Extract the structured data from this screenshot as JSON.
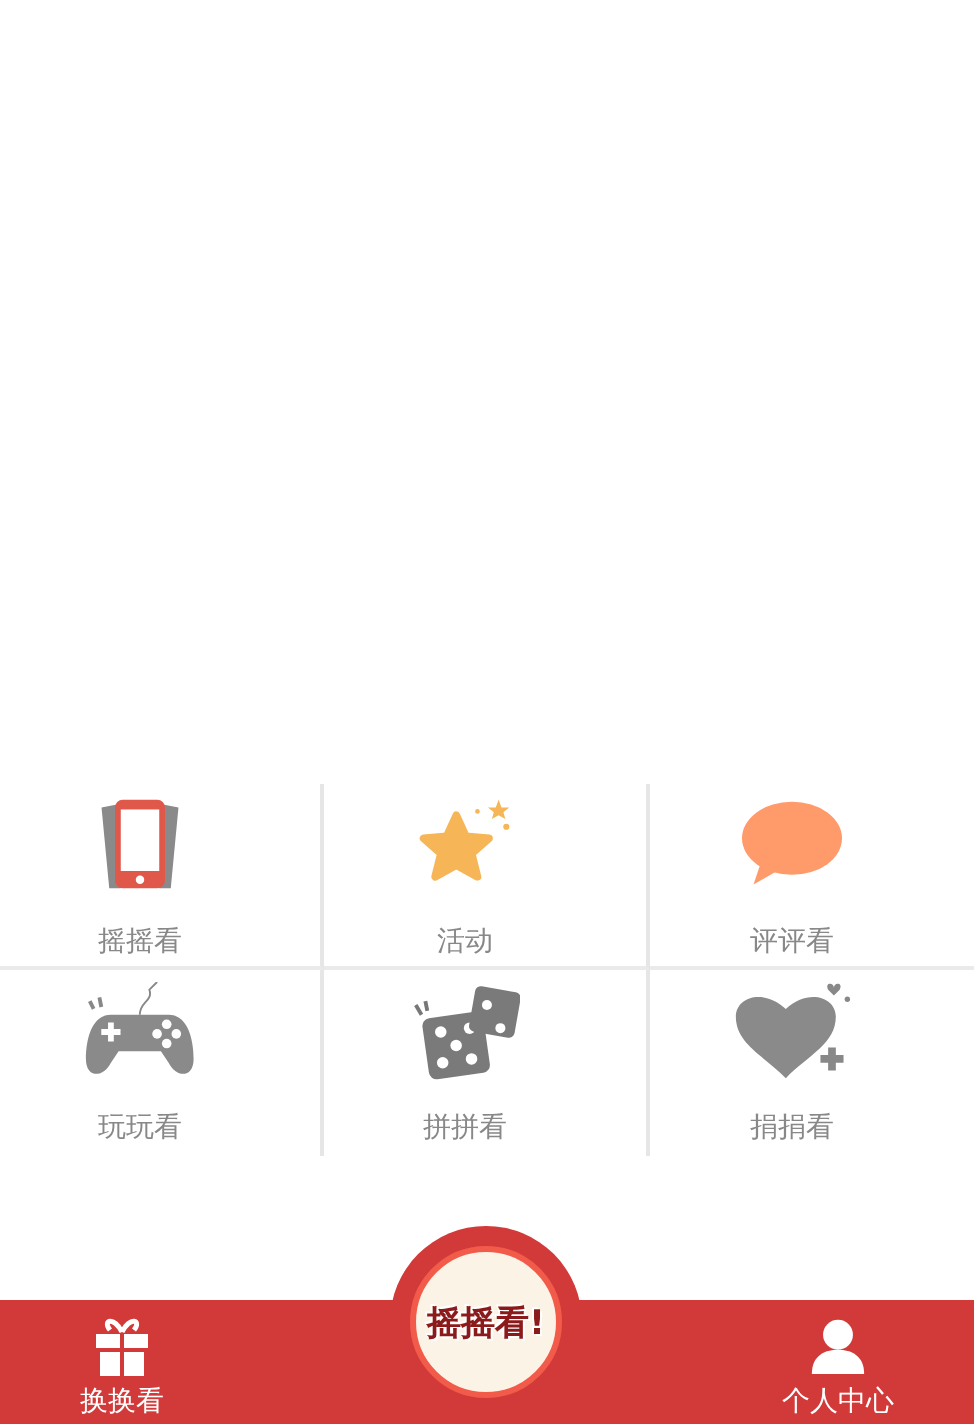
{
  "grid": [
    {
      "kind": "phone",
      "label": "摇摇看"
    },
    {
      "kind": "star",
      "label": "活动"
    },
    {
      "kind": "chat",
      "label": "评评看"
    },
    {
      "kind": "gamepad",
      "label": "玩玩看"
    },
    {
      "kind": "dice",
      "label": "拼拼看"
    },
    {
      "kind": "heart",
      "label": "捐捐看"
    }
  ],
  "bottom_bar": {
    "left": {
      "kind": "gift",
      "label": "换换看"
    },
    "center": {
      "label": "摇摇看!"
    },
    "right": {
      "kind": "person",
      "label": "个人中心"
    }
  }
}
